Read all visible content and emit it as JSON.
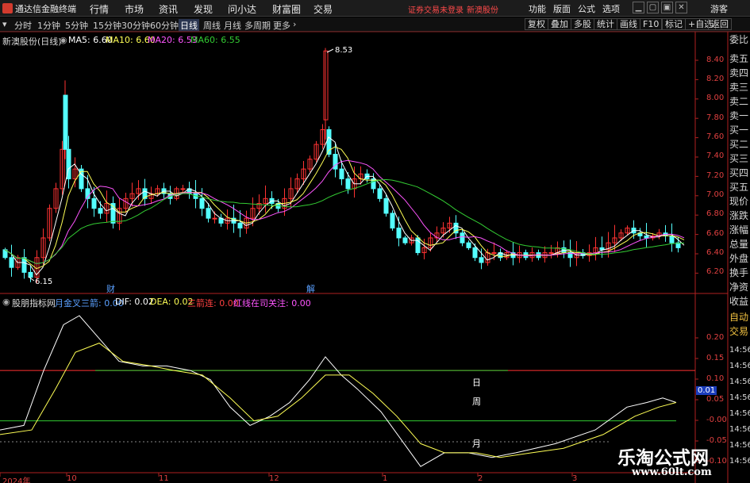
{
  "app": {
    "title": "通达信金融终端"
  },
  "menu": [
    "行情",
    "市场",
    "资讯",
    "发现",
    "问小达",
    "财富圈",
    "交易"
  ],
  "notice": {
    "trade": "证券交易未登录",
    "stock": "新澳股份"
  },
  "topright": [
    "功能",
    "版面",
    "公式",
    "选项"
  ],
  "window_buttons": [
    "▁",
    "▢",
    "▣",
    "✕"
  ],
  "guest": "游客",
  "periods": [
    "分时",
    "1分钟",
    "5分钟",
    "15分钟",
    "30分钟",
    "60分钟",
    "日线",
    "周线",
    "月线",
    "多周期",
    "更多"
  ],
  "period_active": "日线",
  "toolbar_right": [
    "复权",
    "叠加",
    "多股",
    "统计",
    "画线",
    "F10",
    "标记",
    "+自选",
    "返回"
  ],
  "ma_info": {
    "stock": "新澳股份(日线)",
    "ma5": "MA5: 6.60",
    "ma10": "MA10: 6.60",
    "ma20": "MA20: 6.53",
    "ma60": "MA60: 6.55"
  },
  "indicator_info": {
    "name": "股朋指标网",
    "a": "月金叉三箭: 0.00",
    "dif": "DIF: 0.02",
    "dea": "DEA: 0.02",
    "b": "三箭连: 0.00",
    "c": "红线在司关注: 0.00"
  },
  "price_ticks": [
    "8.40",
    "8.20",
    "8.00",
    "7.80",
    "7.60",
    "7.40",
    "7.20",
    "7.00",
    "6.80",
    "6.60",
    "6.40",
    "6.20"
  ],
  "ind_ticks": [
    "0.20",
    "0.15",
    "0.10",
    "0.05",
    "-0.00",
    "-0.05",
    "-0.10"
  ],
  "ind_current": "0.01",
  "max_label": "8.53",
  "min_label": "6.15",
  "date_ticks": [
    "2024年",
    "10",
    "11",
    "12",
    "1",
    "2",
    "3"
  ],
  "events": [
    "财",
    "解"
  ],
  "ref_labels": {
    "day": "日",
    "week": "周",
    "month": "月"
  },
  "side_panel": [
    "委比",
    "卖五",
    "卖四",
    "卖三",
    "卖二",
    "卖一",
    "买一",
    "买二",
    "买三",
    "买四",
    "买五",
    "现价",
    "涨跌",
    "涨幅",
    "总量",
    "外盘",
    "换手",
    "净资",
    "收益",
    "自动",
    "交易"
  ],
  "side_times": [
    "14:56",
    "14:56",
    "14:56",
    "14:56",
    "14:56",
    "14:56",
    "14:56",
    "14:56"
  ],
  "watermark": {
    "cn": "乐淘公式网",
    "url": "www.60lt.com"
  },
  "colors": {
    "up": "#ff3232",
    "down": "#54ffff",
    "ma5": "#ffffff",
    "ma10": "#ffff55",
    "ma20": "#ff55ff",
    "ma60": "#33cc33",
    "axis": "#b02020",
    "dif": "#ffffff",
    "dea": "#ffff55"
  },
  "chart_data": {
    "type": "line",
    "price_axis_ylim": [
      6.1,
      8.55
    ],
    "indicator_axis_ylim": [
      -0.12,
      0.22
    ],
    "day_line": 0.1,
    "week_line": -0.01,
    "candles_count": 118
  }
}
